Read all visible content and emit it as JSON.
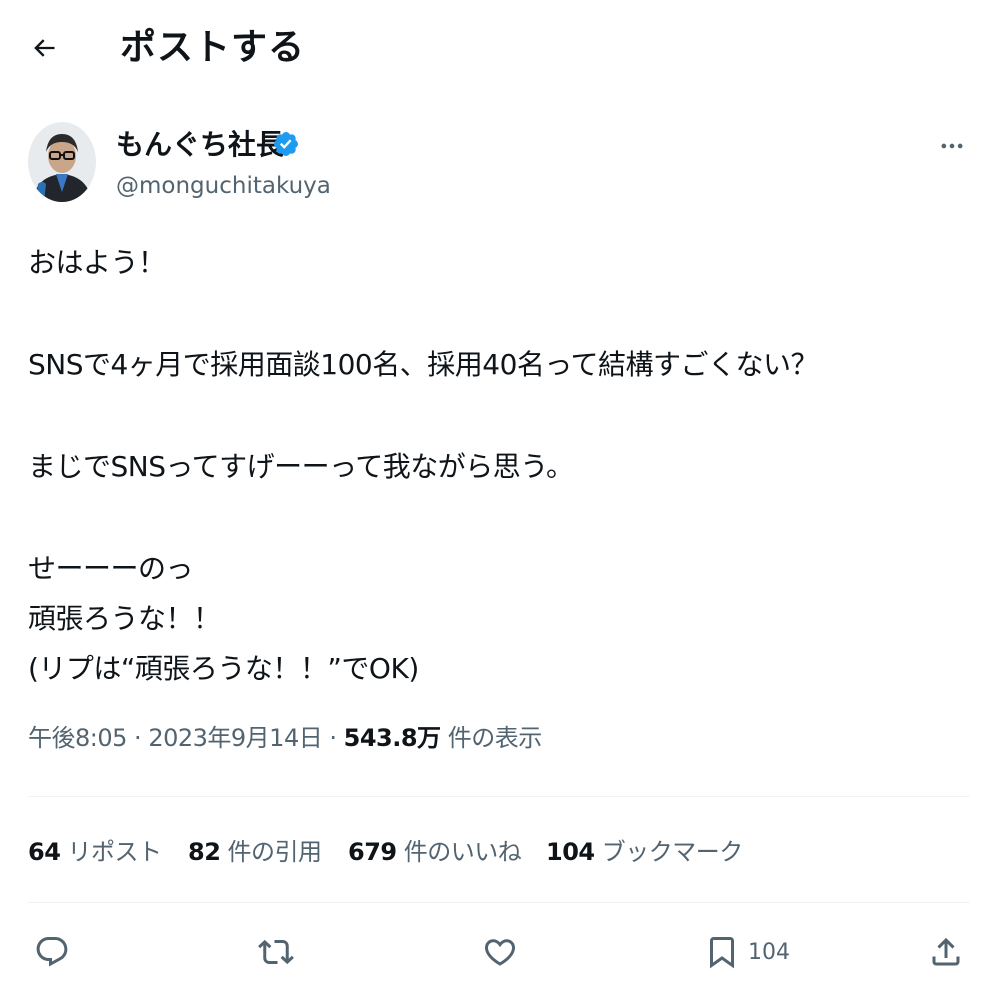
{
  "header": {
    "title": "ポストする",
    "back_icon": "arrow-left-icon"
  },
  "author": {
    "display_name": "もんぐち社長",
    "handle": "@monguchitakuya",
    "verified_icon": "verified-badge-icon",
    "verified_color": "#1d9bf0",
    "more_icon": "more-horizontal-icon"
  },
  "tweet": {
    "lines": [
      "おはよう！",
      "",
      "SNSで4ヶ月で採用面談100名、採用40名って結構すごくない？",
      "",
      "まじでSNSってすげーーって我ながら思う。",
      "",
      "せーーーのっ",
      "頑張ろうな！！",
      "(リプは“頑張ろうな！！”でOK)"
    ]
  },
  "meta": {
    "time": "午後8:05",
    "separator": "·",
    "date": "2023年9月14日",
    "views_count": "543.8万",
    "views_label": "件の表示"
  },
  "stats": {
    "reposts": {
      "count": "64",
      "label": "リポスト"
    },
    "quotes": {
      "count": "82",
      "label": "件の引用"
    },
    "likes": {
      "count": "679",
      "label": "件のいいね"
    },
    "bookmarks": {
      "count": "104",
      "label": "ブックマーク"
    }
  },
  "actions": {
    "reply_icon": "reply-icon",
    "repost_icon": "repost-icon",
    "like_icon": "heart-icon",
    "bookmark_icon": "bookmark-icon",
    "bookmark_count": "104",
    "share_icon": "share-icon"
  },
  "colors": {
    "text_primary": "#0f1419",
    "text_secondary": "#536471",
    "divider": "#eff3f4",
    "accent": "#1d9bf0"
  }
}
